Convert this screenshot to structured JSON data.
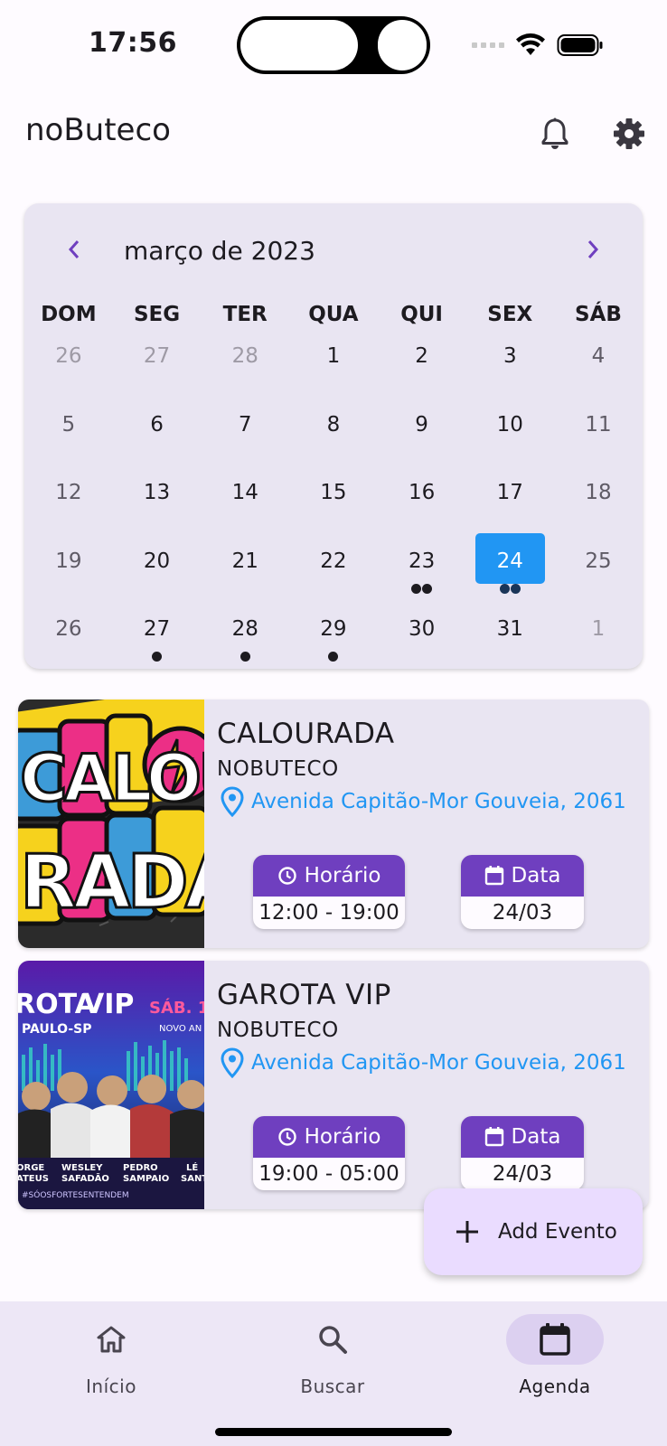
{
  "status": {
    "time": "17:56"
  },
  "app": {
    "title": "noButeco"
  },
  "header_icons": [
    "bell-icon",
    "gear-icon"
  ],
  "calendar": {
    "month_label": "março de 2023",
    "weekdays": [
      "DOM",
      "SEG",
      "TER",
      "QUA",
      "QUI",
      "SEX",
      "SÁB"
    ],
    "selected_day": "24",
    "weeks": [
      [
        {
          "d": "26",
          "out": true
        },
        {
          "d": "27",
          "out": true
        },
        {
          "d": "28",
          "out": true
        },
        {
          "d": "1"
        },
        {
          "d": "2"
        },
        {
          "d": "3"
        },
        {
          "d": "4"
        }
      ],
      [
        {
          "d": "5"
        },
        {
          "d": "6"
        },
        {
          "d": "7"
        },
        {
          "d": "8"
        },
        {
          "d": "9"
        },
        {
          "d": "10"
        },
        {
          "d": "11"
        }
      ],
      [
        {
          "d": "12"
        },
        {
          "d": "13"
        },
        {
          "d": "14"
        },
        {
          "d": "15"
        },
        {
          "d": "16"
        },
        {
          "d": "17"
        },
        {
          "d": "18"
        }
      ],
      [
        {
          "d": "19"
        },
        {
          "d": "20"
        },
        {
          "d": "21"
        },
        {
          "d": "22"
        },
        {
          "d": "23",
          "events": 2
        },
        {
          "d": "24",
          "events": 2,
          "selected": true
        },
        {
          "d": "25"
        }
      ],
      [
        {
          "d": "26"
        },
        {
          "d": "27",
          "events": 1
        },
        {
          "d": "28",
          "events": 1
        },
        {
          "d": "29",
          "events": 1
        },
        {
          "d": "30"
        },
        {
          "d": "31"
        },
        {
          "d": "1",
          "out": true
        }
      ]
    ]
  },
  "events": [
    {
      "title": "CALOURADA",
      "venue": "NOBUTECO",
      "address": "Avenida Capitão-Mor Gouveia, 2061",
      "time_label": "Horário",
      "time_value": "12:00 - 19:00",
      "date_label": "Data",
      "date_value": "24/03",
      "poster_text": [
        "CALOU",
        "RADA"
      ]
    },
    {
      "title": "GAROTA VIP",
      "venue": "NOBUTECO",
      "address": "Avenida Capitão-Mor Gouveia, 2061",
      "time_label": "Horário",
      "time_value": "19:00 - 05:00",
      "date_label": "Data",
      "date_value": "24/03",
      "poster_text": [
        "ROTA",
        "VIP",
        "SÁB. 1",
        "PAULO-SP",
        "NOVO AN",
        "ORGE",
        "WESLEY",
        "PEDRO",
        "LÉ",
        "ATEUS",
        "SAFADÃO",
        "SAMPAIO",
        "SANT",
        "#SÓOSFORTESENTENDEM"
      ]
    }
  ],
  "fab": {
    "label": "Add Evento"
  },
  "nav": [
    {
      "label": "Início",
      "icon": "home-icon"
    },
    {
      "label": "Buscar",
      "icon": "search-icon"
    },
    {
      "label": "Agenda",
      "icon": "calendar-icon",
      "active": true
    }
  ],
  "colors": {
    "primary": "#6f3fbf",
    "selected_day": "#2196f3",
    "address": "#2196f3",
    "card": "#e9e5f2",
    "fab": "#eadcff",
    "nav_bar": "#ede7f6"
  }
}
